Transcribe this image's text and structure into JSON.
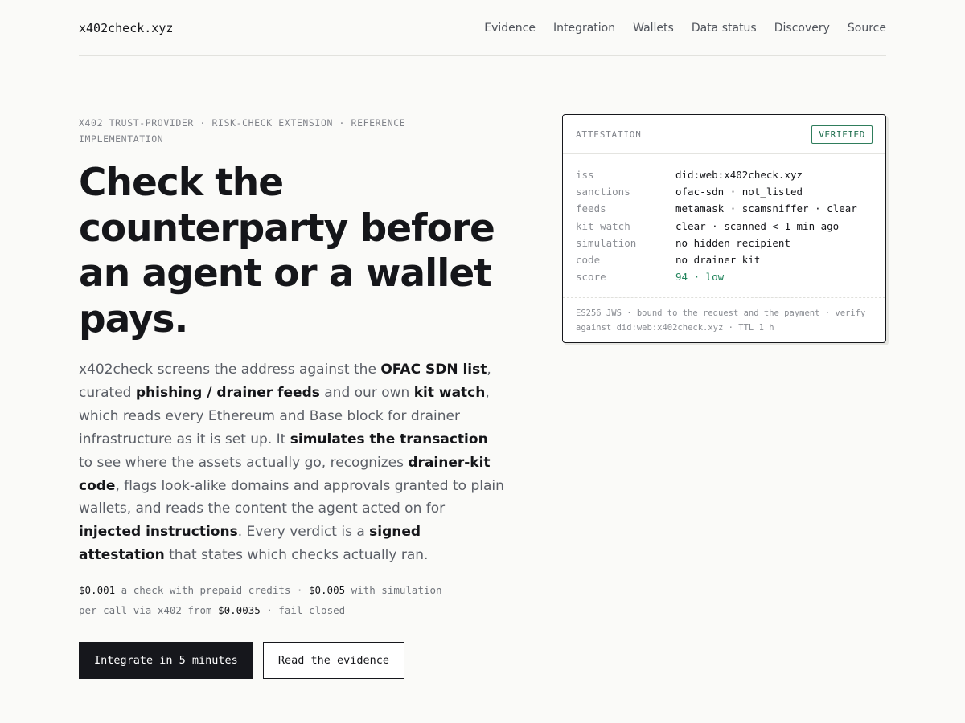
{
  "header": {
    "brand": "x402check.xyz",
    "nav": [
      "Evidence",
      "Integration",
      "Wallets",
      "Data status",
      "Discovery",
      "Source"
    ]
  },
  "hero": {
    "eyebrow": "X402 TRUST-PROVIDER · RISK-CHECK EXTENSION · REFERENCE IMPLEMENTATION",
    "headline": "Check the counterparty before an agent or a wallet pays.",
    "lede": [
      {
        "t": "x402check screens the address against the ",
        "b": false
      },
      {
        "t": "OFAC SDN list",
        "b": true
      },
      {
        "t": ", curated ",
        "b": false
      },
      {
        "t": "phishing / drainer feeds",
        "b": true
      },
      {
        "t": " and our own ",
        "b": false
      },
      {
        "t": "kit watch",
        "b": true
      },
      {
        "t": ", which reads every Ethereum and Base block for drainer infrastructure as it is set up. It ",
        "b": false
      },
      {
        "t": "simulates the transaction",
        "b": true
      },
      {
        "t": " to see where the assets actually go, recognizes ",
        "b": false
      },
      {
        "t": "drainer-kit code",
        "b": true
      },
      {
        "t": ", flags look-alike domains and approvals granted to plain wallets, and reads the content the agent acted on for ",
        "b": false
      },
      {
        "t": "injected instructions",
        "b": true
      },
      {
        "t": ". Every verdict is a ",
        "b": false
      },
      {
        "t": "signed attestation",
        "b": true
      },
      {
        "t": " that states which checks actually ran.",
        "b": false
      }
    ],
    "pricing": {
      "line1": [
        {
          "t": "$0.001",
          "price": true
        },
        {
          "t": " a check with prepaid credits · ",
          "price": false
        },
        {
          "t": "$0.005",
          "price": true
        },
        {
          "t": " with simulation",
          "price": false
        }
      ],
      "line2": [
        {
          "t": "per call via x402 from ",
          "price": false
        },
        {
          "t": "$0.0035",
          "price": true
        },
        {
          "t": " · fail-closed",
          "price": false
        }
      ]
    },
    "cta_primary": "Integrate in 5 minutes",
    "cta_secondary": "Read the evidence"
  },
  "attestation": {
    "title": "ATTESTATION",
    "badge": "VERIFIED",
    "rows": [
      {
        "k": "iss",
        "v": "did:web:x402check.xyz",
        "good": false
      },
      {
        "k": "sanctions",
        "v": "ofac-sdn · not_listed",
        "good": false
      },
      {
        "k": "feeds",
        "v": "metamask · scamsniffer · clear",
        "good": false
      },
      {
        "k": "kit watch",
        "v": "clear · scanned < 1 min ago",
        "good": false
      },
      {
        "k": "simulation",
        "v": "no hidden recipient",
        "good": false
      },
      {
        "k": "code",
        "v": "no drainer kit",
        "good": false
      },
      {
        "k": "score",
        "v": "94 · low",
        "good": true
      }
    ],
    "footer": "ES256 JWS · bound to the request and the payment · verify against did:web:x402check.xyz · TTL 1 h"
  },
  "colors": {
    "background": "#fafaf8",
    "ink": "#15161a",
    "muted": "#80838a",
    "verified_green": "#23855d"
  }
}
